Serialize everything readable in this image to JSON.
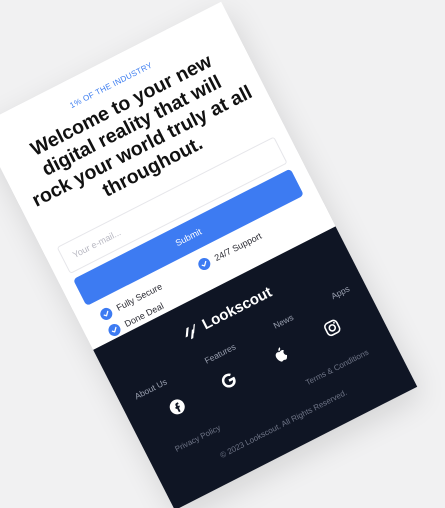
{
  "hero": {
    "kicker": "1% OF THE INDUSTRY",
    "headline": "Welcome to your new digital reality that will rock your world truly at all throughout."
  },
  "form": {
    "email_placeholder": "Your e-mail...",
    "submit_label": "Submit"
  },
  "features": [
    {
      "label": "24/7 Support"
    },
    {
      "label": "Fully Secure"
    },
    {
      "label": "Done Deal"
    }
  ],
  "footer": {
    "brand": "Lookscout",
    "nav": [
      "About Us",
      "Features",
      "News",
      "Apps"
    ],
    "social_icons": [
      "facebook-icon",
      "google-icon",
      "apple-icon",
      "instagram-icon"
    ],
    "legal": [
      "Privacy Policy",
      "Terms & Conditions"
    ],
    "copyright": "© 2023 Lookscout. All Rights Reserved."
  },
  "colors": {
    "accent": "#3d7bf2",
    "footer_bg": "#0f1524",
    "page_bg": "#f1f1f2"
  }
}
